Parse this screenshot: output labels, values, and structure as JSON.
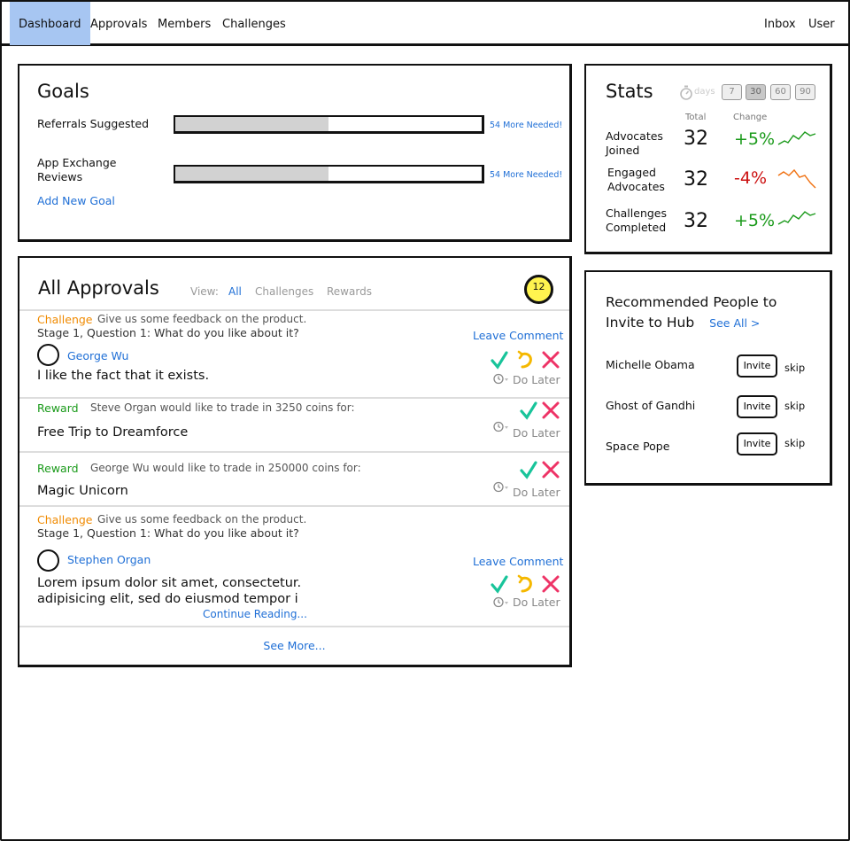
{
  "nav": {
    "items": [
      "Dashboard",
      "Approvals",
      "Members",
      "Challenges"
    ],
    "right": [
      "Inbox",
      "User"
    ]
  },
  "goals": {
    "title": "Goals",
    "items": [
      {
        "label": "Referrals Suggested",
        "progress": 0.5,
        "note": "54 More Needed!"
      },
      {
        "label": "App Exchange Reviews",
        "progress": 0.5,
        "note": "54 More Needed!"
      }
    ],
    "add_link": "Add New Goal"
  },
  "stats": {
    "title": "Stats",
    "days_label": "days",
    "day_options": [
      "7",
      "30",
      "60",
      "90"
    ],
    "selected_day": "30",
    "col_total": "Total",
    "col_change": "Change",
    "rows": [
      {
        "label_1": "Advocates",
        "label_2": "Joined",
        "total": "32",
        "change": "+5%",
        "trend": "up"
      },
      {
        "label_1": "Engaged",
        "label_2": "Advocates",
        "total": "32",
        "change": "-4%",
        "trend": "down"
      },
      {
        "label_1": "Challenges",
        "label_2": "Completed",
        "total": "32",
        "change": "+5%",
        "trend": "up"
      }
    ]
  },
  "approvals": {
    "title": "All Approvals",
    "view_label": "View:",
    "filters": [
      "All",
      "Challenges",
      "Rewards"
    ],
    "badge_count": "12",
    "items": [
      {
        "type": "Challenge",
        "description": "Give us some feedback on the product.",
        "question": "Stage 1, Question 1: What do you like about it?",
        "leave_comment": "Leave Comment",
        "user": "George Wu",
        "text": "I like the fact that it exists.",
        "do_later": "Do Later"
      },
      {
        "type": "Reward",
        "description": "Steve Organ would like to trade in 3250 coins for:",
        "text": "Free Trip to Dreamforce",
        "do_later": "Do Later"
      },
      {
        "type": "Reward",
        "description": "George Wu would like to trade in 250000 coins for:",
        "text": "Magic Unicorn",
        "do_later": "Do Later"
      },
      {
        "type": "Challenge",
        "description": "Give us some feedback on the product.",
        "question": "Stage 1, Question 1: What do you like about it?",
        "leave_comment": "Leave Comment",
        "user": "Stephen Organ",
        "text_line_1": "Lorem ipsum dolor sit amet, consectetur.",
        "text_line_2": "adipisicing elit, sed do eiusmod tempor i",
        "continue": "Continue Reading...",
        "do_later": "Do Later"
      }
    ],
    "see_more": "See More..."
  },
  "recommend": {
    "title_line_1": "Recommended People to",
    "title_line_2": "Invite to Hub",
    "see_all": "See All >",
    "invite_label": "Invite",
    "skip_label": "skip",
    "people": [
      "Michelle Obama",
      "Ghost of Gandhi",
      "Space Pope"
    ]
  },
  "colors": {
    "accent_blue": "#1f6fd6",
    "nav_active": "#a7c6f2",
    "challenge": "#f08a00",
    "reward": "#1a9a1a",
    "positive": "#1a9a1a",
    "negative": "#cc1111",
    "approve": "#18c49a",
    "undo": "#f5b800",
    "reject": "#ee3366",
    "badge": "#fff44f"
  },
  "icons": [
    "timer-icon",
    "check-icon",
    "undo-icon",
    "close-icon",
    "clock-icon",
    "sparkline-icon",
    "avatar-icon"
  ]
}
